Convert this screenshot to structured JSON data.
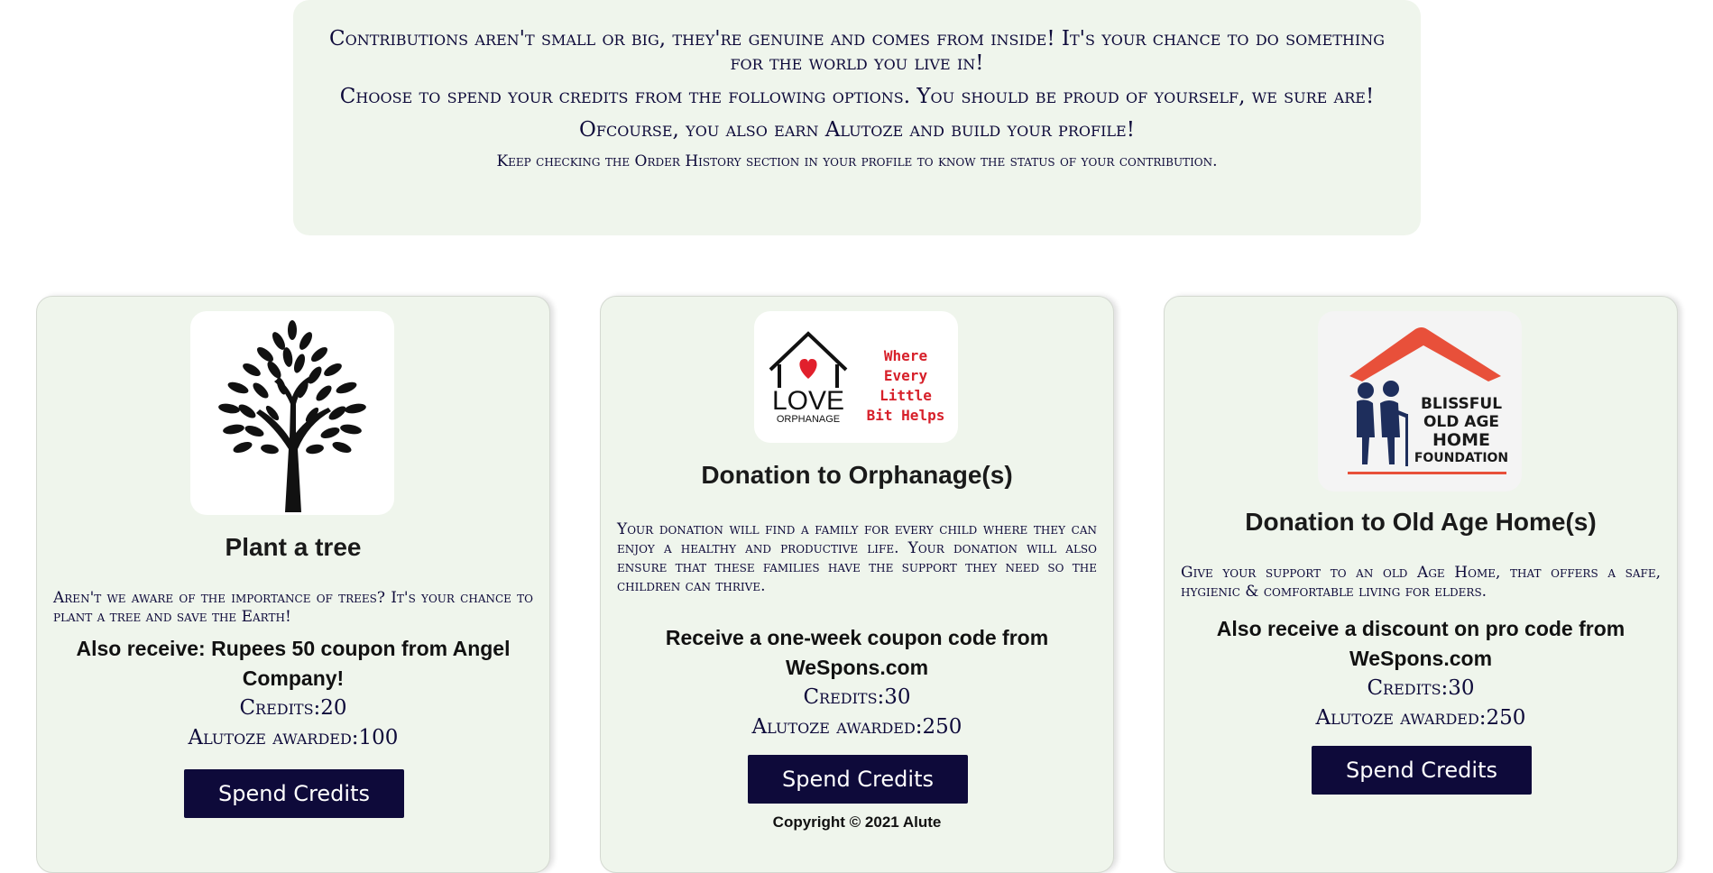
{
  "intro": {
    "line1": "Contributions aren't small or big, they're genuine and comes from inside! It's your chance to do something for the world you live in!",
    "line2": "Choose to spend your credits from the following options. You should be proud of yourself, we sure are!",
    "line3": "Ofcourse, you also earn Alutoze and build your profile!",
    "line4": "Keep checking the Order History section in your profile to know the status of your contribution."
  },
  "cards": [
    {
      "logo_icon": "tree-icon",
      "title": "Plant a tree",
      "description": "Aren't we aware of the importance of trees? It's your chance to plant a tree and save the Earth!",
      "bonus": "Also receive: Rupees 50 coupon from Angel Company!",
      "credits": "Credits:20",
      "alutoze": "Alutoze awarded:100",
      "button": "Spend Credits"
    },
    {
      "logo_icon": "love-orphanage-logo",
      "logo_text": {
        "word": "LOVE",
        "sub": "ORPHANAGE",
        "tagline": [
          "Where",
          "Every",
          "Little",
          "Bit Helps"
        ]
      },
      "title": "Donation to Orphanage(s)",
      "description": "Your donation will find a family for every child where they can enjoy a healthy and productive life. Your donation will also ensure that these families have the support they need so the children can thrive.",
      "bonus": "Receive a one-week coupon code from WeSpons.com",
      "credits": "Credits:30",
      "alutoze": "Alutoze awarded:250",
      "button": "Spend Credits"
    },
    {
      "logo_icon": "old-age-home-logo",
      "logo_text": [
        "BLISSFUL",
        "OLD AGE",
        "HOME",
        "FOUNDATION"
      ],
      "title": "Donation to Old Age Home(s)",
      "description": "Give your support to an old Age Home, that offers a safe, hygienic & comfortable living for elders.",
      "bonus": "Also receive a discount on pro code from WeSpons.com",
      "credits": "Credits:30",
      "alutoze": "Alutoze awarded:250",
      "button": "Spend Credits"
    }
  ],
  "footer": {
    "copyright": "Copyright © 2021 Alute"
  },
  "colors": {
    "card_bg": "#eff5ec",
    "button_bg": "#0e0a3a",
    "heart": "#e1202c",
    "tagline": "#d7202a",
    "roof": "#e8503a",
    "figures": "#1e2e5c"
  }
}
